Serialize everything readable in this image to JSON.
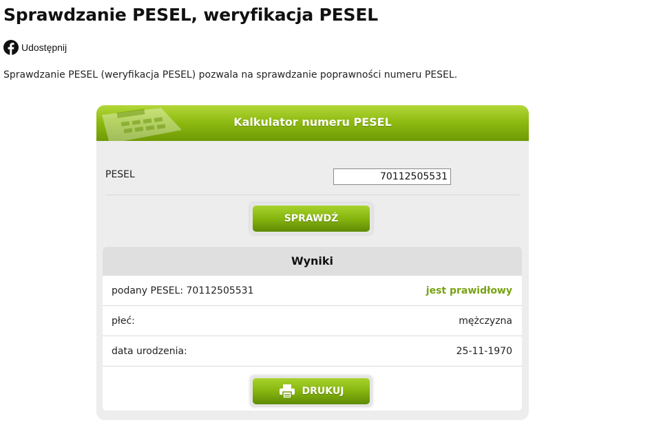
{
  "page": {
    "title": "Sprawdzanie PESEL, weryfikacja PESEL",
    "share_label": "Udostępnij",
    "intro": "Sprawdzanie PESEL (weryfikacja PESEL) pozwala na sprawdzanie poprawności numeru PESEL."
  },
  "calculator": {
    "title": "Kalkulator numeru PESEL",
    "field_label": "PESEL",
    "input_value": "70112505531",
    "check_button": "SPRAWDŹ"
  },
  "results": {
    "title": "Wyniki",
    "rows": [
      {
        "label": "podany PESEL: 70112505531",
        "value": "jest prawidłowy"
      },
      {
        "label": "płeć:",
        "value": "mężczyzna"
      },
      {
        "label": "data urodzenia:",
        "value": "25-11-1970"
      }
    ],
    "print_button": "DRUKUJ"
  },
  "icons": {
    "share": "facebook-icon",
    "print": "printer-icon",
    "header_image": "calculator-icon"
  },
  "colors": {
    "accent_green": "#86b50f",
    "valid_text": "#77a111",
    "panel_bg": "#ededed"
  }
}
